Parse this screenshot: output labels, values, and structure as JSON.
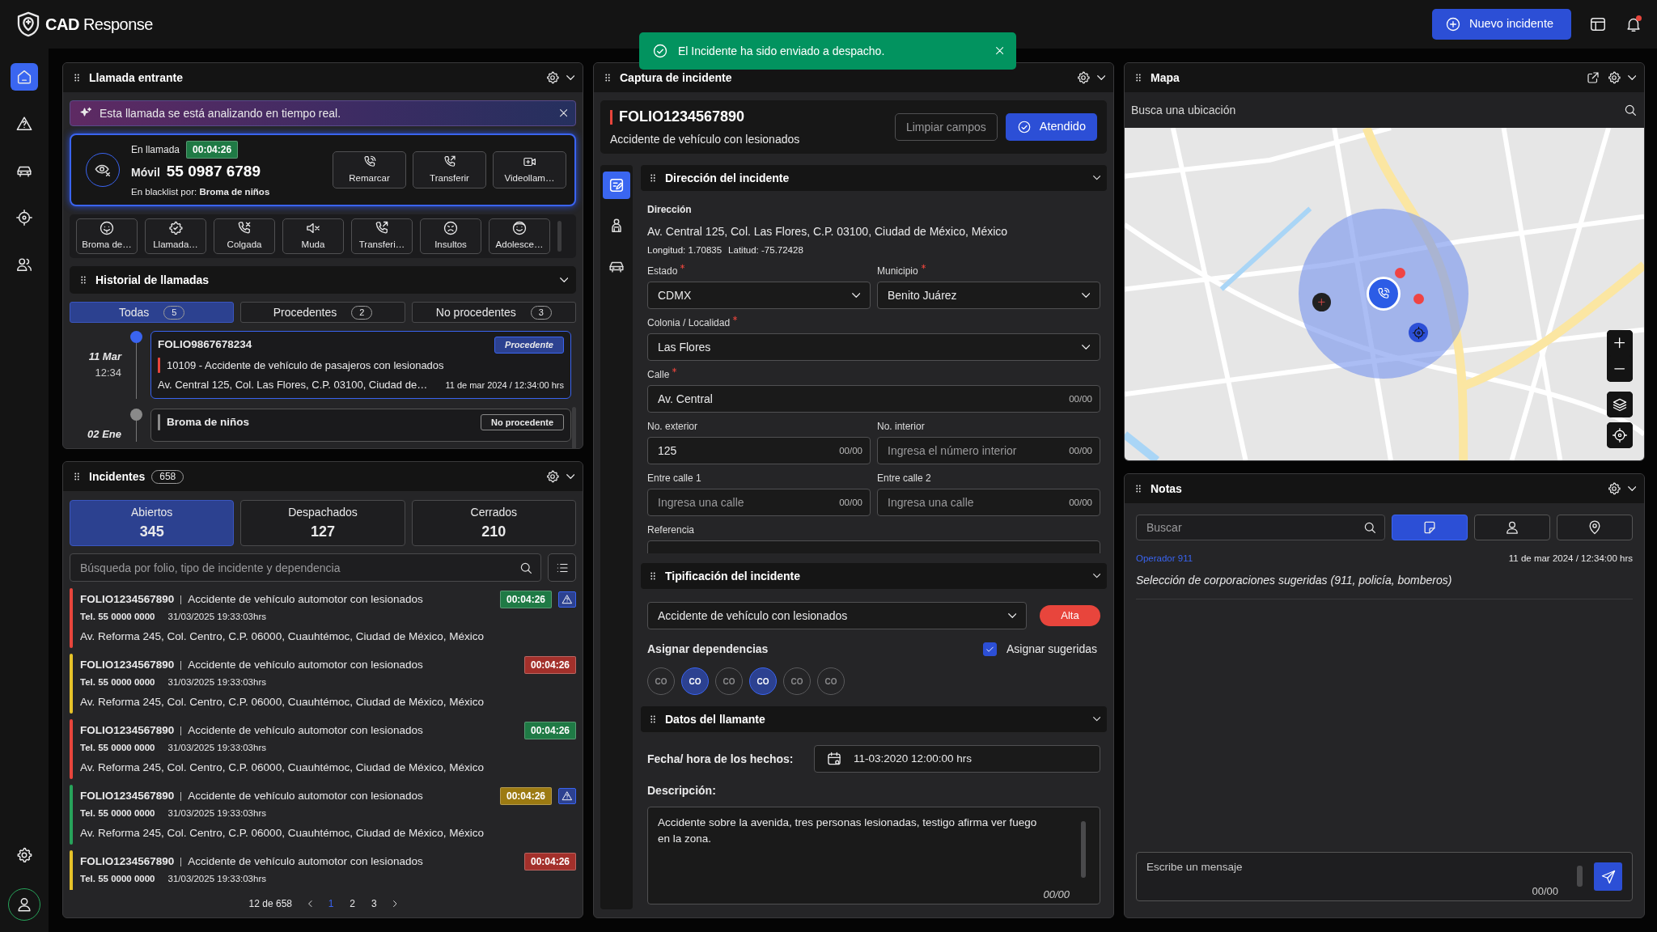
{
  "app": {
    "logo": "**CAD** Response",
    "new_incident": "Nuevo incidente",
    "has_notifications": true
  },
  "rail": [
    {
      "kind": "home",
      "selected": true
    },
    {
      "kind": "alert",
      "selected": false
    },
    {
      "kind": "car",
      "selected": false
    },
    {
      "kind": "target",
      "selected": false
    },
    {
      "kind": "users",
      "selected": false
    }
  ],
  "toast": {
    "message": "El Incidente ha sido enviado a despacho."
  },
  "call": {
    "title": "Llamada entrante",
    "banner": "Esta llamada se está analizando en tiempo real.",
    "status": "En llamada",
    "timer": "00:04:26",
    "line": "Móvil",
    "number": "55 0987 6789",
    "blacklist": "En blacklist por: **Broma de niños**",
    "actions": [
      {
        "kind": "redial",
        "label": "Remarcar"
      },
      {
        "kind": "transfer",
        "label": "Transferir"
      },
      {
        "kind": "video",
        "label": "Videollam…"
      }
    ],
    "tags": [
      {
        "kind": "joke",
        "label": "Broma de…"
      },
      {
        "kind": "gear",
        "label": "Llamada…"
      },
      {
        "kind": "hangup",
        "label": "Colgada"
      },
      {
        "kind": "mute",
        "label": "Muda"
      },
      {
        "kind": "transfer",
        "label": "Transferi…"
      },
      {
        "kind": "angry",
        "label": "Insultos"
      },
      {
        "kind": "smile",
        "label": "Adolesce…"
      }
    ]
  },
  "history": {
    "title": "Historial de llamadas",
    "tabs": [
      {
        "label": "Todas",
        "count": "5",
        "selected": true
      },
      {
        "label": "Procedentes",
        "count": "2",
        "selected": false
      },
      {
        "label": "No procedentes",
        "count": "3",
        "selected": false
      }
    ],
    "entries": [
      {
        "day": "11 Mar",
        "time": "12:34",
        "selected": true,
        "folio": "FOLIO9867678234",
        "status": "Procedente",
        "status_highlighted": true,
        "color": "#e8453c",
        "incident": "10109 - Accidente de vehículo de pasajeros con lesionados",
        "address": "Av. Central 125, Col. Las Flores, C.P. 03100, Ciudad de…",
        "datetime": "11 de mar 2024 / 12:34:00 hrs"
      },
      {
        "day": "02 Ene",
        "selected": false,
        "status": "No procedente",
        "status_highlighted": false,
        "color": "#8a8a8a",
        "incident": "Broma de niños"
      }
    ]
  },
  "incidents": {
    "title": "Incidentes",
    "count": "658",
    "stats": [
      {
        "label": "Abiertos",
        "value": "345",
        "selected": true
      },
      {
        "label": "Despachados",
        "value": "127",
        "selected": false
      },
      {
        "label": "Cerrados",
        "value": "210",
        "selected": false
      }
    ],
    "search_placeholder": "Búsqueda por folio, tipo de incidente y dependencia",
    "items": [
      {
        "color": "#e8453c",
        "folio": "FOLIO1234567890",
        "type": "Accidente de vehículo automotor con lesionados",
        "phone": "Tel. 55 0000 0000",
        "date": "31/03/2025 19:33:03hrs",
        "address": "Av. Reforma 245, Col. Centro, C.P. 06000, Cuauhtémoc, Ciudad de México, México",
        "timer": {
          "text": "00:04:26",
          "color": "#1f7a45"
        },
        "alert": true
      },
      {
        "color": "#e6c229",
        "folio": "FOLIO1234567890",
        "type": "Accidente de vehículo automotor con lesionados",
        "phone": "Tel. 55 0000 0000",
        "date": "31/03/2025 19:33:03hrs",
        "address": "Av. Reforma 245, Col. Centro, C.P. 06000, Cuauhtémoc, Ciudad de México, México",
        "timer": {
          "text": "00:04:26",
          "color": "#a3302b"
        },
        "alert": false
      },
      {
        "color": "#e8453c",
        "folio": "FOLIO1234567890",
        "type": "Accidente de vehículo automotor con lesionados",
        "phone": "Tel. 55 0000 0000",
        "date": "31/03/2025 19:33:03hrs",
        "address": "Av. Reforma 245, Col. Centro, C.P. 06000, Cuauhtémoc, Ciudad de México, México",
        "timer": {
          "text": "00:04:26",
          "color": "#1f7a45"
        },
        "alert": false
      },
      {
        "color": "#27a35a",
        "folio": "FOLIO1234567890",
        "type": "Accidente de vehículo automotor con lesionados",
        "phone": "Tel. 55 0000 0000",
        "date": "31/03/2025 19:33:03hrs",
        "address": "Av. Reforma 245, Col. Centro, C.P. 06000, Cuauhtémoc, Ciudad de México, México",
        "timer": {
          "text": "00:04:26",
          "color": "#9c7a12"
        },
        "alert": true
      },
      {
        "color": "#e6c229",
        "folio": "FOLIO1234567890",
        "type": "Accidente de vehículo automotor con lesionados",
        "phone": "Tel. 55 0000 0000",
        "date": "31/03/2025 19:33:03hrs",
        "timer": {
          "text": "00:04:26",
          "color": "#a3302b"
        },
        "alert": false
      }
    ],
    "pagination": {
      "summary": "12 de 658",
      "pages": [
        {
          "label": "1",
          "selected": true
        },
        {
          "label": "2",
          "selected": false
        },
        {
          "label": "3",
          "selected": false
        }
      ]
    }
  },
  "capture": {
    "title": "Captura de incidente",
    "folio": "FOLIO1234567890",
    "subtitle": "Accidente de vehículo con lesionados",
    "clear_button": "Limpiar campos",
    "done_button": "Atendido",
    "side_tabs": [
      {
        "kind": "edit",
        "selected": true
      },
      {
        "kind": "person",
        "selected": false
      },
      {
        "kind": "car",
        "selected": false
      }
    ],
    "address_section": {
      "title": "Dirección del incidente",
      "label": "Dirección",
      "address": "Av. Central 125, Col. Las Flores, C.P. 03100, Ciudad de México, México",
      "longitude": "Longitud: 1.70835",
      "latitude": "Latitud: -75.72428",
      "rows": [
        [
          {
            "label": "Estado",
            "required": true,
            "kind": "select",
            "value": "CDMX"
          },
          {
            "label": "Municipio",
            "required": true,
            "kind": "select",
            "value": "Benito Juárez"
          }
        ],
        [
          {
            "label": "Colonia / Localidad",
            "required": true,
            "kind": "select",
            "value": "Las Flores"
          }
        ],
        [
          {
            "label": "Calle",
            "required": true,
            "kind": "text",
            "value": "Av. Central",
            "counter": "00/00"
          }
        ],
        [
          {
            "label": "No. exterior",
            "required": false,
            "kind": "text",
            "value": "125",
            "counter": "00/00"
          },
          {
            "label": "No. interior",
            "required": false,
            "kind": "text",
            "placeholder": "Ingresa el número interior",
            "counter": "00/00"
          }
        ],
        [
          {
            "label": "Entre calle 1",
            "required": false,
            "kind": "text",
            "placeholder": "Ingresa una calle",
            "counter": "00/00"
          },
          {
            "label": "Entre calle 2",
            "required": false,
            "kind": "text",
            "placeholder": "Ingresa una calle",
            "counter": "00/00"
          }
        ],
        [
          {
            "label": "Referencia",
            "required": false,
            "kind": "text"
          }
        ]
      ]
    },
    "type_section": {
      "title": "Tipificación del incidente",
      "type": "Accidente de vehículo con lesionados",
      "priority": "Alta",
      "assign_label": "Asignar dependencias",
      "suggested_label": "Asignar sugeridas",
      "suggested_checked": true,
      "agencies": [
        {
          "label": "CO",
          "selected": false
        },
        {
          "label": "CO",
          "selected": true
        },
        {
          "label": "CO",
          "selected": false
        },
        {
          "label": "CO",
          "selected": true
        },
        {
          "label": "CO",
          "selected": false
        },
        {
          "label": "CO",
          "selected": false
        }
      ]
    },
    "caller_section": {
      "title": "Datos del llamante",
      "date_label": "Fecha/ hora de los hechos:",
      "date_value": "11-03:2020 12:00:00 hrs",
      "description_label": "Descripción:",
      "description": "Accidente sobre la avenida, tres personas lesionadas, testigo afirma ver fuego en la zona.",
      "counter": "00/00"
    }
  },
  "map": {
    "title": "Mapa",
    "search_placeholder": "Busca una ubicación"
  },
  "notes": {
    "title": "Notas",
    "search_placeholder": "Buscar",
    "filters": [
      {
        "kind": "note",
        "selected": true
      },
      {
        "kind": "person",
        "selected": false
      },
      {
        "kind": "pin",
        "selected": false
      }
    ],
    "entries": [
      {
        "author": "Operador 911",
        "datetime": "11 de mar 2024 / 12:34:00 hrs",
        "text": "Selección de corporaciones sugeridas (911, policía, bomberos)"
      }
    ],
    "message_placeholder": "Escribe un mensaje",
    "counter": "00/00"
  }
}
